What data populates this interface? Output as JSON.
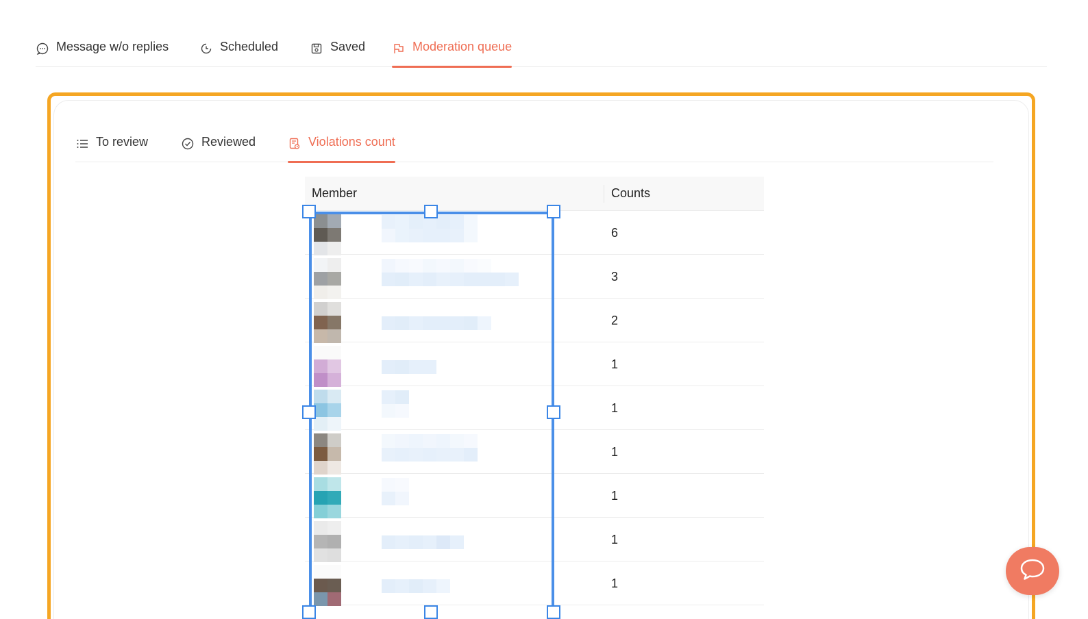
{
  "top_tabs": [
    {
      "label": "Message w/o replies",
      "icon": "chat-bubble-icon",
      "active": false
    },
    {
      "label": "Scheduled",
      "icon": "clock-icon",
      "active": false
    },
    {
      "label": "Saved",
      "icon": "save-icon",
      "active": false
    },
    {
      "label": "Moderation queue",
      "icon": "flag-icon",
      "active": true
    }
  ],
  "sub_tabs": [
    {
      "label": "To review",
      "icon": "list-icon",
      "active": false
    },
    {
      "label": "Reviewed",
      "icon": "check-circle-icon",
      "active": false
    },
    {
      "label": "Violations count",
      "icon": "report-icon",
      "active": true
    }
  ],
  "table": {
    "headers": {
      "member": "Member",
      "counts": "Counts"
    },
    "rows": [
      {
        "count": "6"
      },
      {
        "count": "3"
      },
      {
        "count": "2"
      },
      {
        "count": "1"
      },
      {
        "count": "1"
      },
      {
        "count": "1"
      },
      {
        "count": "1"
      },
      {
        "count": "1"
      },
      {
        "count": "1"
      }
    ]
  },
  "colors": {
    "accent": "#ef6d53",
    "highlight_frame": "#f5a623",
    "selection": "#4a8fe8",
    "chat_button": "#f07b62"
  },
  "chat_button_icon": "chat-bubble-icon"
}
